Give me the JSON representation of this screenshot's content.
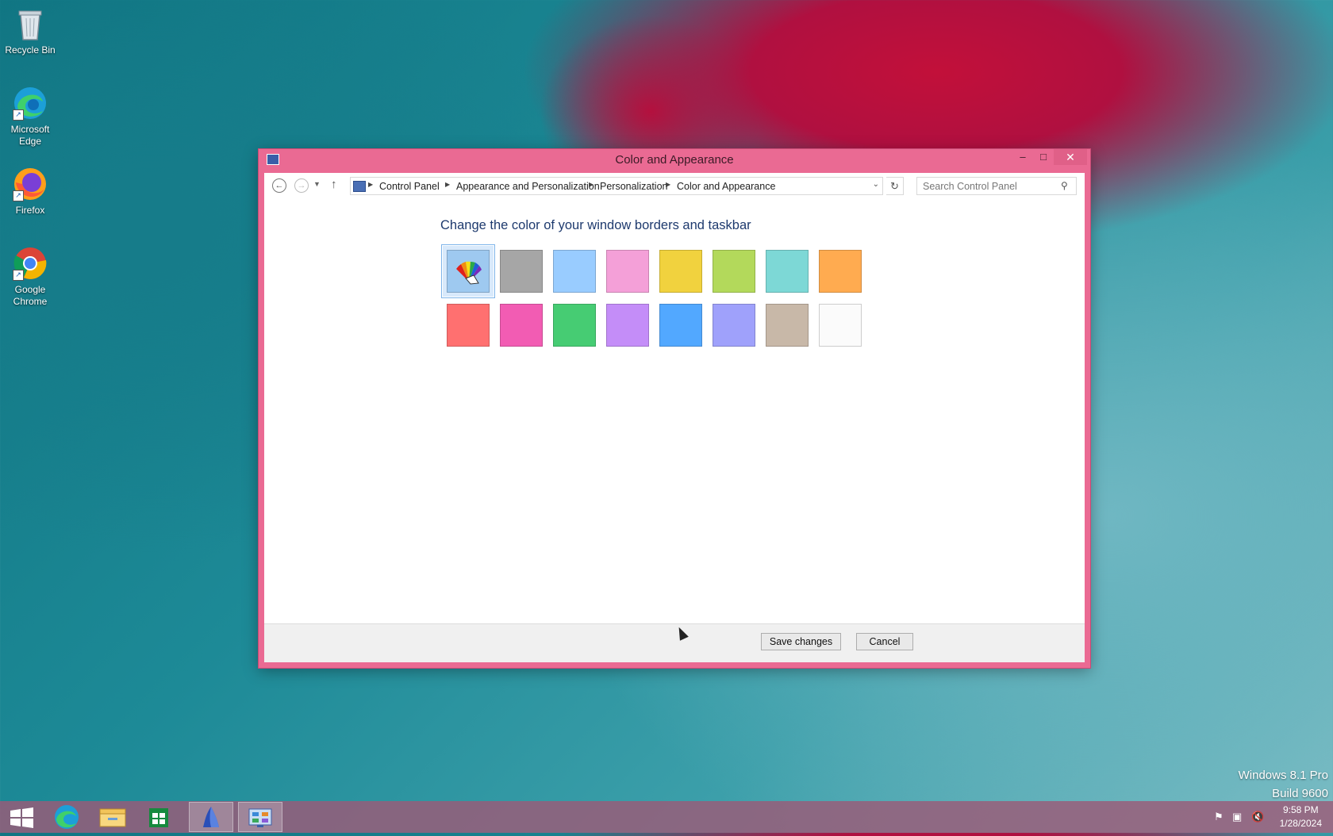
{
  "desktop": {
    "icons": [
      {
        "label": "Recycle Bin"
      },
      {
        "label": "Microsoft Edge"
      },
      {
        "label": "Firefox"
      },
      {
        "label": "Google Chrome"
      }
    ]
  },
  "window": {
    "title": "Color and Appearance",
    "breadcrumb": [
      "Control Panel",
      "Appearance and Personalization",
      "Personalization",
      "Color and Appearance"
    ],
    "search_placeholder": "Search Control Panel",
    "heading": "Change the color of your window borders and taskbar",
    "swatches": [
      {
        "id": "automatic",
        "color": "#9ec9f0",
        "selected": true
      },
      {
        "color": "#a6a6a6"
      },
      {
        "color": "#99ccff"
      },
      {
        "color": "#f4a0d8"
      },
      {
        "color": "#f1d23e"
      },
      {
        "color": "#b3d95b"
      },
      {
        "color": "#7dd8d6"
      },
      {
        "color": "#ffab50"
      },
      {
        "color": "#ff7070"
      },
      {
        "color": "#f25cb3"
      },
      {
        "color": "#46cc73"
      },
      {
        "color": "#c48df8"
      },
      {
        "color": "#52a8ff"
      },
      {
        "color": "#9fa1fb"
      },
      {
        "color": "#c8b8a8"
      },
      {
        "color": "#fbfbfb"
      }
    ],
    "buttons": {
      "save": "Save changes",
      "cancel": "Cancel"
    },
    "controls": {
      "minimize": "–",
      "maximize": "□",
      "close": "✕"
    }
  },
  "watermark": {
    "line1": "Windows 8.1 Pro",
    "line2": "Build 9600"
  },
  "taskbar": {
    "items": [
      "start-icon",
      "edge-icon",
      "file-explorer-icon",
      "store-icon",
      "app-icon",
      "control-panel-icon"
    ],
    "clock": {
      "time": "9:58 PM",
      "date": "1/28/2024"
    }
  }
}
